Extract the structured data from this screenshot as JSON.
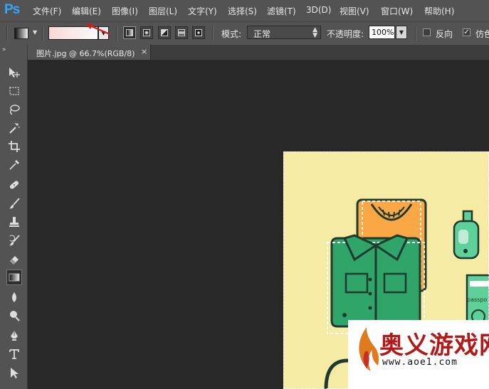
{
  "app": {
    "logo": "Ps"
  },
  "menu": [
    {
      "label": "文件(F)"
    },
    {
      "label": "编辑(E)"
    },
    {
      "label": "图像(I)"
    },
    {
      "label": "图层(L)"
    },
    {
      "label": "文字(Y)"
    },
    {
      "label": "选择(S)"
    },
    {
      "label": "滤镜(T)"
    },
    {
      "label": "3D(D)"
    },
    {
      "label": "视图(V)"
    },
    {
      "label": "窗口(W)"
    },
    {
      "label": "帮助(H)"
    }
  ],
  "options": {
    "gradient_colors": [
      "#f7d8d8",
      "#fdfafa"
    ],
    "gradient_types": [
      "linear",
      "radial",
      "angle",
      "reflected",
      "diamond"
    ],
    "active_gradient_type": "linear",
    "mode_label": "模式:",
    "mode_value": "正常",
    "opacity_label": "不透明度:",
    "opacity_value": "100%",
    "reverse_label": "反向",
    "reverse_checked": false,
    "dither_label": "仿色",
    "dither_checked": true
  },
  "tools": [
    "move-icon",
    "marquee-icon",
    "lasso-icon",
    "magic-wand-icon",
    "crop-icon",
    "eyedropper-icon",
    "healing-brush-icon",
    "brush-icon",
    "clone-stamp-icon",
    "history-brush-icon",
    "eraser-icon",
    "gradient-icon",
    "blur-icon",
    "dodge-icon",
    "pen-icon",
    "type-icon",
    "path-selection-icon"
  ],
  "active_tool": "gradient-icon",
  "document": {
    "tab_title": "图片.jpg @ 66.7%(RGB/8)",
    "close_glyph": "×"
  },
  "artwork": {
    "background": "#f5eba4",
    "tag_text": "passpo",
    "colors": {
      "orange": "#f9a845",
      "green": "#2fa56a",
      "mint": "#5ed09a",
      "outline": "#1f3a2c"
    }
  },
  "watermark": {
    "text": "奥义游戏网",
    "url": "www.aoe1.com",
    "color": "#b21918"
  },
  "annotation_color": "#d21a1a"
}
